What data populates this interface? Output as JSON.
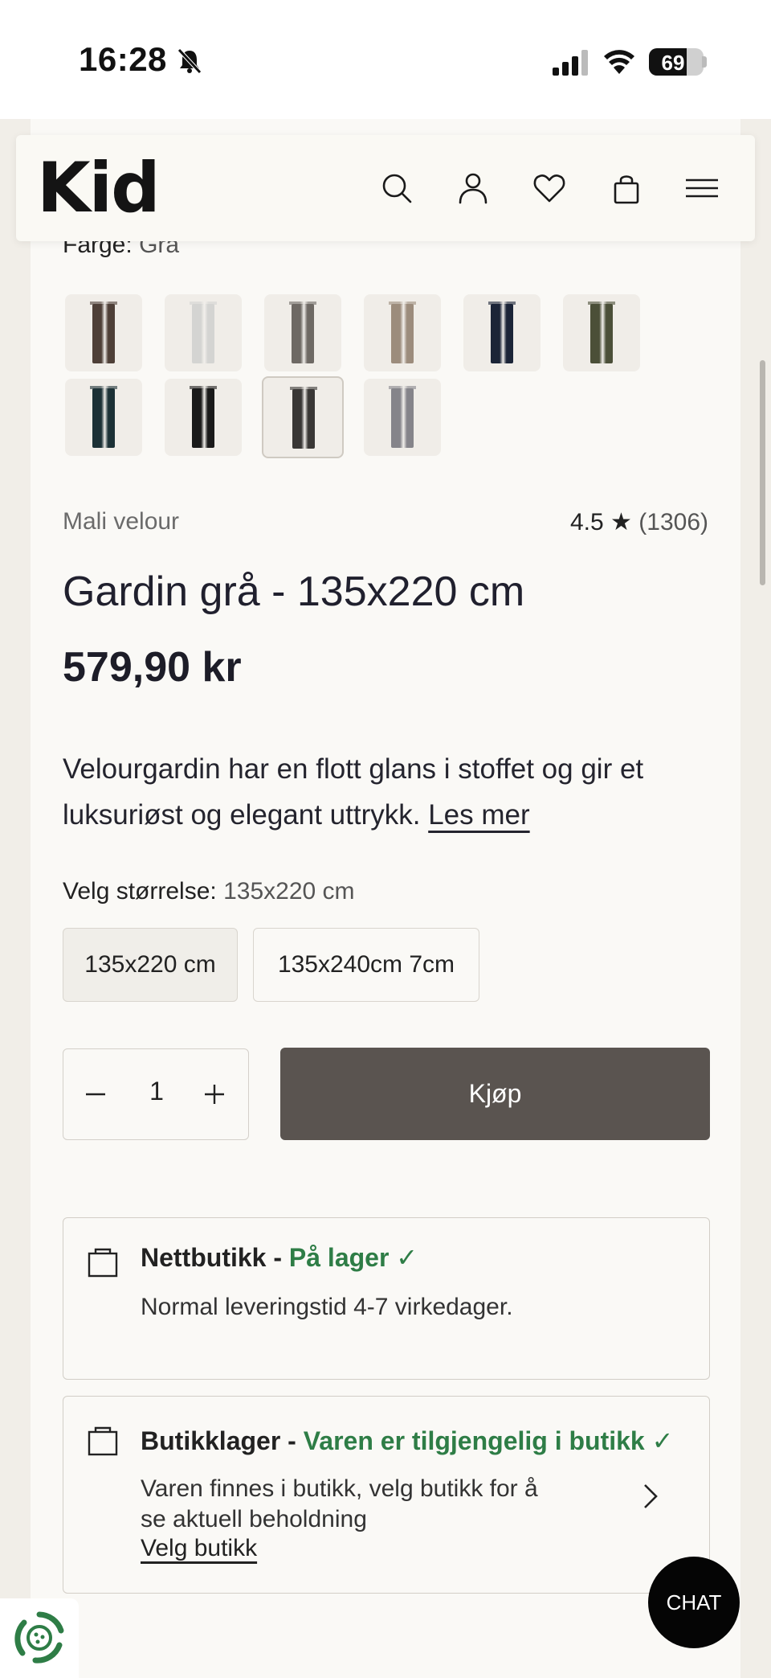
{
  "status_bar": {
    "time": "16:28",
    "battery": "69",
    "battery_level": 0.69
  },
  "header": {
    "logo": "Kid",
    "icons": [
      "search-icon",
      "account-icon",
      "heart-icon",
      "cart-icon",
      "menu-icon"
    ]
  },
  "color": {
    "label": "Farge:",
    "value": "Grå"
  },
  "swatches": [
    {
      "color": "#4e3f37"
    },
    {
      "color": "#d4d4d2"
    },
    {
      "color": "#6e6964"
    },
    {
      "color": "#9c8c7c"
    },
    {
      "color": "#1b2437"
    },
    {
      "color": "#4b4f38"
    },
    {
      "color": "#1c3136"
    },
    {
      "color": "#1a1a1a"
    },
    {
      "color": "#393735",
      "selected": true
    },
    {
      "color": "#85848a"
    }
  ],
  "product": {
    "series": "Mali velour",
    "rating": "4.5 ★",
    "rating_count": "(1306)",
    "title": "Gardin grå - 135x220 cm",
    "price": "579,90 kr",
    "description": "Velourgardin har en flott glans i stoffet og gir et luksuriøst og elegant uttrykk. ",
    "read_more": "Les mer"
  },
  "size": {
    "label": "Velg størrelse:",
    "value": "135x220 cm",
    "options": [
      "135x220 cm",
      "135x240cm 7cm"
    ]
  },
  "quantity": {
    "value": "1"
  },
  "buy_label": "Kjøp",
  "online_stock": {
    "title": "Nettbutikk - ",
    "status": "På lager ✓",
    "text": "Normal leveringstid 4-7 virkedager."
  },
  "store_stock": {
    "title": "Butikklager - ",
    "status": "Varen er tilgjengelig i butikk ✓",
    "text_line1": "Varen finnes i butikk, velg butikk for å",
    "text_line2": "se aktuell beholdning",
    "link": "Velg butikk"
  },
  "chat_label": "CHAT",
  "colors": {
    "accent_green": "#2e7d46",
    "buy_button": "#5a5450",
    "page_bg": "#f1eee8"
  }
}
